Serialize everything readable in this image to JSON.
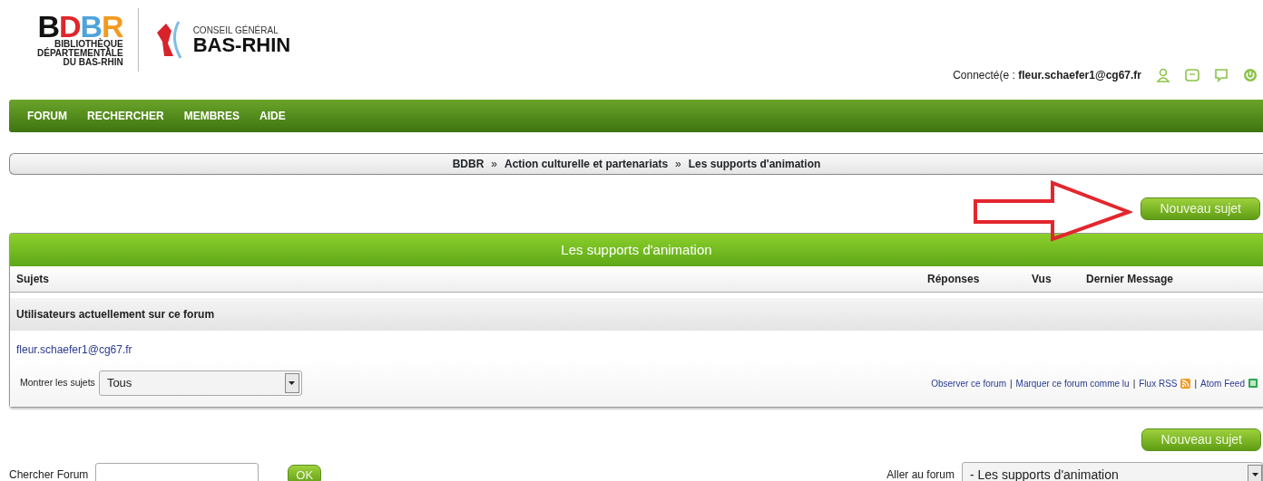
{
  "logo": {
    "letters": [
      {
        "text": "B",
        "color": "#111111"
      },
      {
        "text": "D",
        "color": "#e0262b"
      },
      {
        "text": "B",
        "color": "#4fa3dc"
      },
      {
        "text": "R",
        "color": "#f29a1f"
      }
    ],
    "lines": [
      "BIBLIOTHÈQUE",
      "DÉPARTEMENTALE",
      "DU BAS-RHIN"
    ],
    "partner_caption": "CONSEIL GÉNÉRAL",
    "partner_name": "BAS-RHIN"
  },
  "user_bar": {
    "label": "Connecté(e :",
    "user": "fleur.schaefer1@cg67.fr"
  },
  "nav": [
    "FORUM",
    "RECHERCHER",
    "MEMBRES",
    "AIDE"
  ],
  "breadcrumb": {
    "separator": "»",
    "items": [
      "BDBR",
      "Action culturelle et partenariats",
      "Les supports d'animation"
    ]
  },
  "new_topic_top": "Nouveau sujet",
  "forum": {
    "title": "Les supports d'animation",
    "columns": [
      "Sujets",
      "Réponses",
      "Vus",
      "Dernier Message"
    ],
    "online_heading": "Utilisateurs actuellement sur ce forum",
    "online_users": [
      "fleur.schaefer1@cg67.fr"
    ],
    "filter": {
      "label": "Montrer les sujets",
      "value": "Tous"
    },
    "link_separator": "|",
    "links": [
      {
        "text": "Observer ce forum"
      },
      {
        "text": "Marquer ce forum comme lu"
      },
      {
        "text": "Flux RSS",
        "kind": "rss"
      },
      {
        "text": "Atom Feed",
        "kind": "feed"
      }
    ]
  },
  "new_topic_bottom": "Nouveau sujet",
  "search": {
    "label": "Chercher Forum",
    "button": "OK"
  },
  "jump": {
    "label": "Aller au forum",
    "value": "- Les supports d'animation"
  }
}
